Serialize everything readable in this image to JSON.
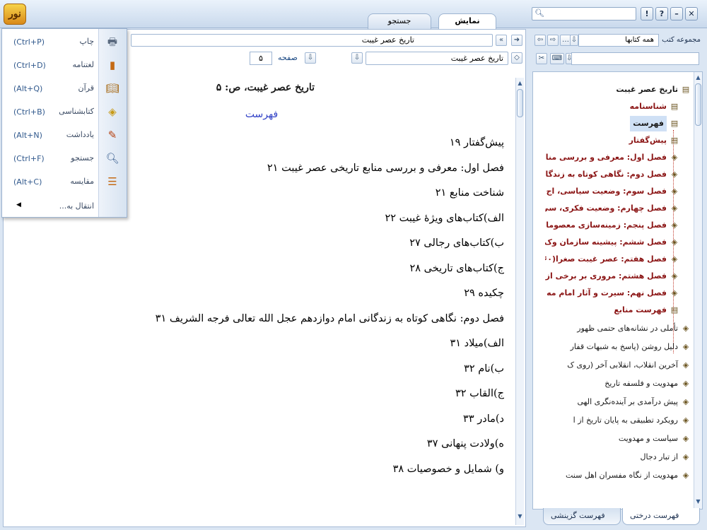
{
  "header": {
    "logo_text": "نور",
    "tabs": [
      {
        "label": "نمایش",
        "active": true
      },
      {
        "label": "جستجو",
        "active": false
      }
    ],
    "window_buttons": [
      "!",
      "?",
      "–",
      "✕"
    ]
  },
  "content": {
    "breadcrumb": "تاریخ عصر غیبت",
    "title_field": "تاریخ عصر غیبت",
    "page_label": "صفحه",
    "page_value": "۵",
    "heading": "تاریخ عصر غیبت، ص: ۵",
    "subtitle": "فهرست",
    "lines": [
      "پیش‌گفتار ۱۹",
      "فصل اول: معرفی و بررسی منابع تاریخی عصر غیبت ۲۱",
      "شناخت منابع ۲۱",
      "الف)کتاب‌های ویژهٔ غیبت ۲۲",
      "ب)کتاب‌های رجالی ۲۷",
      "ج)کتاب‌های تاریخی ۲۸",
      "چکیده ۲۹",
      "فصل دوم: نگاهی کوتاه به زندگانی امام دوازدهم عجل الله تعالی فرجه الشریف ۳۱",
      "الف)میلاد ۳۱",
      "ب)نام ۳۲",
      "ج)القاب ۳۲",
      "د)مادر ۳۳",
      "ه)ولادت پنهانی ۳۷",
      "و) شمایل و خصوصیات ۳۸"
    ]
  },
  "menu": {
    "items": [
      {
        "label": "چاپ",
        "shortcut": "(Ctrl+P)",
        "icon": "printer-icon"
      },
      {
        "label": "لغتنامه",
        "shortcut": "(Ctrl+D)",
        "icon": "dictionary-icon"
      },
      {
        "label": "قرآن",
        "shortcut": "(Alt+Q)",
        "icon": "quran-icon"
      },
      {
        "label": "کتابشناسی",
        "shortcut": "(Ctrl+B)",
        "icon": "bibliography-icon"
      },
      {
        "label": "یادداشت",
        "shortcut": "(Alt+N)",
        "icon": "note-icon"
      },
      {
        "label": "جستجو",
        "shortcut": "(Ctrl+F)",
        "icon": "search-icon"
      },
      {
        "label": "مقایسه",
        "shortcut": "(Alt+C)",
        "icon": "compare-icon"
      }
    ],
    "more_label": "انتقال به..."
  },
  "right_panel": {
    "collection_label": "مجموعه کتب",
    "collection_value": "همه کتابها",
    "tree": [
      {
        "label": "تاریخ عصر غیبت",
        "type": "root"
      },
      {
        "label": "شناسنامه",
        "type": "doc"
      },
      {
        "label": "فهرست",
        "type": "doc",
        "selected": true
      },
      {
        "label": "پیش‌گفتار",
        "type": "doc"
      },
      {
        "label": "فصل اول: معرفی و بررسی منابع",
        "type": "chapter"
      },
      {
        "label": "فصل دوم: نگاهی کوتاه به زندگا",
        "type": "chapter"
      },
      {
        "label": "فصل سوم: وضعیت سیاسی، اج",
        "type": "chapter"
      },
      {
        "label": "فصل چهارم: وضعیت فکری، سی",
        "type": "chapter"
      },
      {
        "label": "فصل پنجم: زمینه‌سازی معصوما",
        "type": "chapter"
      },
      {
        "label": "فصل ششم: پیشینه سازمان وک",
        "type": "chapter"
      },
      {
        "label": "فصل هفتم: عصر غیبت صغرا(۲۶۰",
        "type": "chapter"
      },
      {
        "label": "فصل هشتم: مروری بر برخی از",
        "type": "chapter"
      },
      {
        "label": "فصل نهم: سیرت و آثار امام مه",
        "type": "chapter"
      },
      {
        "label": "فهرست منابع",
        "type": "doc"
      },
      {
        "label": "تأملی در نشانه‌های حتمی ظهور",
        "type": "book"
      },
      {
        "label": "دلیل روشن (پاسخ به شبهات قفار",
        "type": "book"
      },
      {
        "label": "آخرین انقلاب، انقلابی آخر (روی ک",
        "type": "book"
      },
      {
        "label": "مهدویت و فلسفه تاریخ",
        "type": "book"
      },
      {
        "label": "پیش درآمدی بر آینده‌نگری الهی",
        "type": "book"
      },
      {
        "label": "رویکرد تطبیقی به پایان تاریخ از ا",
        "type": "book"
      },
      {
        "label": "سیاست و مهدویت",
        "type": "book"
      },
      {
        "label": "از تبار دجال",
        "type": "book"
      },
      {
        "label": "مهدویت از نگاه مفسران اهل سنت",
        "type": "book"
      }
    ],
    "bottom_tabs": [
      {
        "label": "فهرست درختی",
        "active": true
      },
      {
        "label": "فهرست گزینشی",
        "active": false
      }
    ]
  }
}
